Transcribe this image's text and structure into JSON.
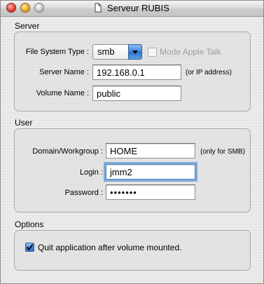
{
  "window": {
    "title": "Serveur RUBIS",
    "icon": "document-icon"
  },
  "server": {
    "group_label": "Server",
    "fs_type_label": "File System Type :",
    "fs_type_value": "smb",
    "apple_talk_label": "Mode Apple Talk",
    "apple_talk_checked": false,
    "server_name_label": "Server Name :",
    "server_name_value": "192.168.0.1",
    "server_name_hint": "(or IP address)",
    "volume_name_label": "Volume Name :",
    "volume_name_value": "public"
  },
  "user": {
    "group_label": "User",
    "domain_label": "Domain/Workgroup :",
    "domain_value": "HOME",
    "domain_hint": "(only for SMB)",
    "login_label": "Login :",
    "login_value": "jmm2",
    "password_label": "Password :",
    "password_value": "•••••••"
  },
  "options": {
    "group_label": "Options",
    "quit_label": "Quit application after volume mounted.",
    "quit_checked": true
  },
  "colors": {
    "accent": "#3e86dc",
    "focus_ring": "#7ea8d8"
  }
}
